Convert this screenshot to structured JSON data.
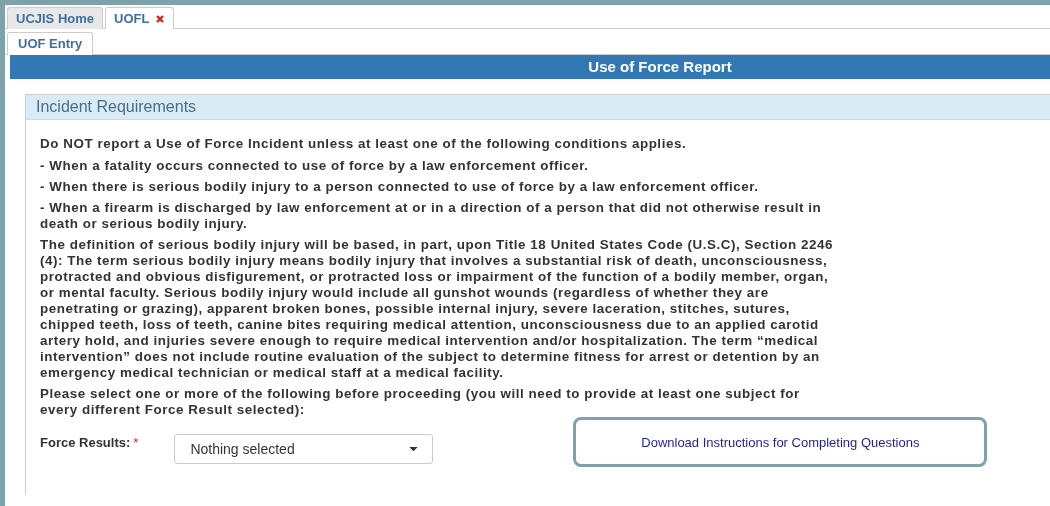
{
  "tabs": [
    {
      "label": "UCJIS Home",
      "selected": false,
      "closable": false
    },
    {
      "label": "UOFL",
      "selected": true,
      "closable": true
    }
  ],
  "subtabs": [
    {
      "label": "UOF Entry",
      "selected": true
    }
  ],
  "report_title": "Use of Force Report",
  "panel": {
    "heading": "Incident Requirements",
    "paragraphs": [
      "Do NOT report a Use of Force Incident unless at least one of the following conditions applies.",
      "- When a fatality occurs connected to use of force by a law enforcement officer.",
      "- When there is serious bodily injury to a person connected to use of force by a law enforcement officer.",
      "- When a firearm is discharged by law enforcement at or in a direction of a person that did not otherwise result in death or serious bodily injury.",
      "The definition of serious bodily injury will be based, in part, upon Title 18 United States Code (U.S.C), Section 2246 (4):  The term serious bodily injury means bodily injury that involves a substantial risk of death, unconsciousness, protracted and obvious disfigurement, or protracted loss or impairment of the function of a bodily member, organ, or mental faculty. Serious bodily injury would include all gunshot wounds (regardless of whether they are penetrating or grazing), apparent broken bones, possible internal injury, severe laceration, stitches, sutures, chipped teeth, loss of teeth, canine bites requiring medical attention, unconsciousness due to an applied carotid artery hold, and injuries severe enough to require medical intervention and/or hospitalization.   The term “medical intervention” does not include routine evaluation of the subject to determine fitness for arrest or detention by an emergency medical technician or medical staff at a medical facility.",
      "Please select one or more of the following before proceeding (you will need to provide at least one subject for every different Force Result selected):"
    ],
    "force_results": {
      "label": "Force Results:",
      "required_mark": "*",
      "value": "Nothing selected"
    },
    "download_link": "Download Instructions for Completing Questions"
  }
}
